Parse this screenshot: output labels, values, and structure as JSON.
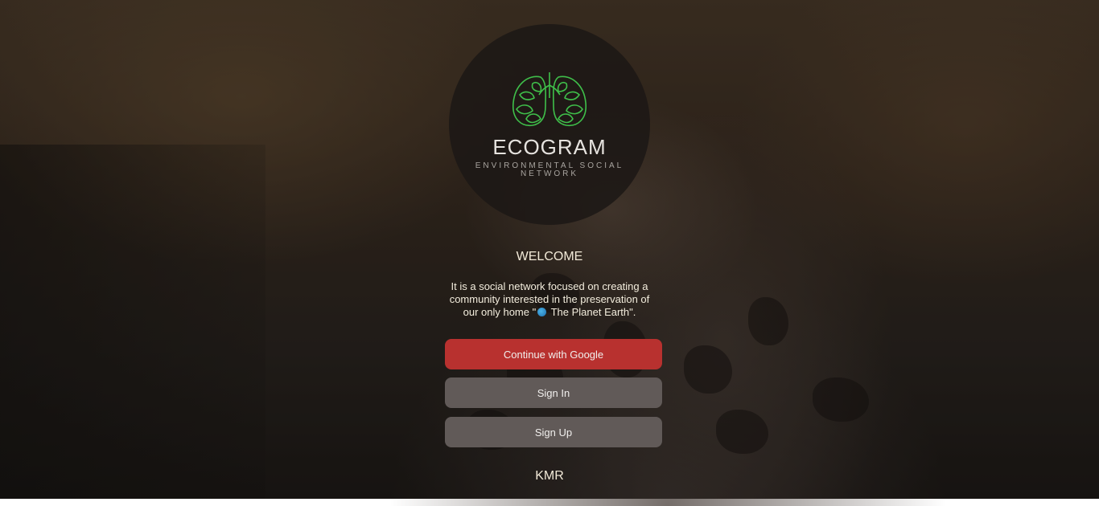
{
  "brand": {
    "name": "ECOGRAM",
    "tagline": "ENVIRONMENTAL SOCIAL NETWORK",
    "logo_color": "#3fbf4a"
  },
  "welcome": {
    "heading": "WELCOME",
    "description_part1": "It is a social network focused on creating a community interested in the preservation of our only home \"",
    "description_part2": " The Planet Earth\"."
  },
  "actions": {
    "google_label": "Continue with Google",
    "signin_label": "Sign In",
    "signup_label": "Sign Up",
    "google_color": "#b8312f",
    "secondary_color": "#615a58"
  },
  "footer": {
    "text": "KMR"
  }
}
